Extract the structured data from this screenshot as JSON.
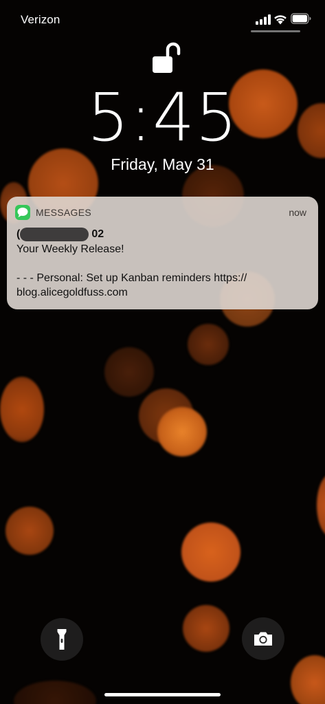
{
  "status_bar": {
    "carrier": "Verizon",
    "signal_icon": "cellular-signal-icon",
    "wifi_icon": "wifi-icon",
    "battery_icon": "battery-icon",
    "battery_level": 1.0
  },
  "lock": {
    "icon": "unlocked-padlock-icon",
    "time": "5:45",
    "date": "Friday, May 31"
  },
  "notification": {
    "app_icon": "messages-icon",
    "app_name": "MESSAGES",
    "time": "now",
    "sender_prefix": "(",
    "sender_suffix": "02",
    "body_line1": "Your Weekly Release!",
    "body_line2": "- - - Personal: Set up Kanban reminders https://",
    "body_line3": "blog.alicegoldfuss.com"
  },
  "controls": {
    "flashlight_icon": "flashlight-icon",
    "camera_icon": "camera-icon"
  },
  "colors": {
    "bokeh_orange": "#d9641e",
    "notification_bg": "#ded6d0",
    "messages_green": "#35c759"
  }
}
